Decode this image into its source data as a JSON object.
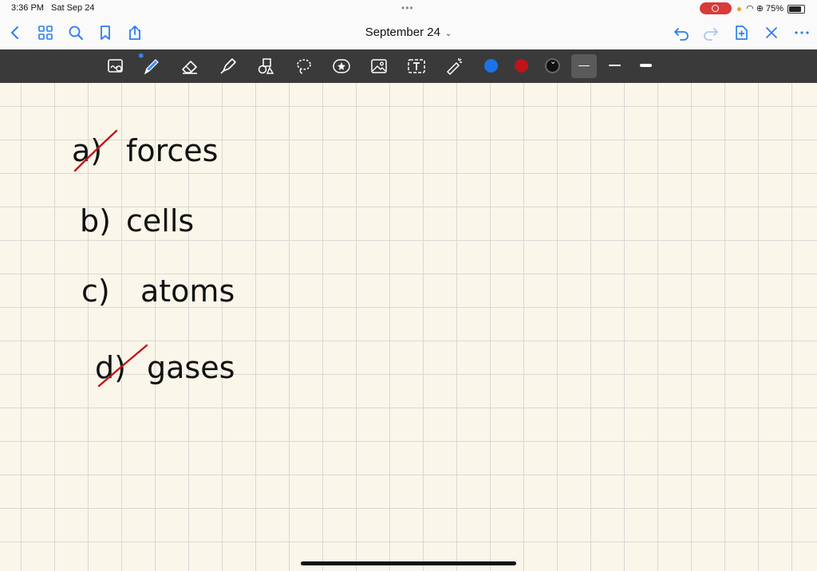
{
  "status": {
    "time": "3:36 PM",
    "date": "Sat Sep 24",
    "battery": "75%"
  },
  "document": {
    "title": "September 24"
  },
  "toolbar": {
    "tools": [
      "zoom-window-icon",
      "pen-icon",
      "eraser-icon",
      "highlighter-icon",
      "shapes-icon",
      "lasso-icon",
      "sticker-icon",
      "image-icon",
      "text-icon",
      "laser-pointer-icon"
    ],
    "colors": {
      "blue": "#1a73e8",
      "red": "#c0141a",
      "black": "#111111"
    }
  },
  "notes": {
    "a": {
      "letter": "a)",
      "word": "forces",
      "crossed": true
    },
    "b": {
      "letter": "b)",
      "word": "cells",
      "crossed": false
    },
    "c": {
      "letter": "c)",
      "word": "atoms",
      "crossed": false
    },
    "d": {
      "letter": "d)",
      "word": "gases",
      "crossed": true
    }
  }
}
